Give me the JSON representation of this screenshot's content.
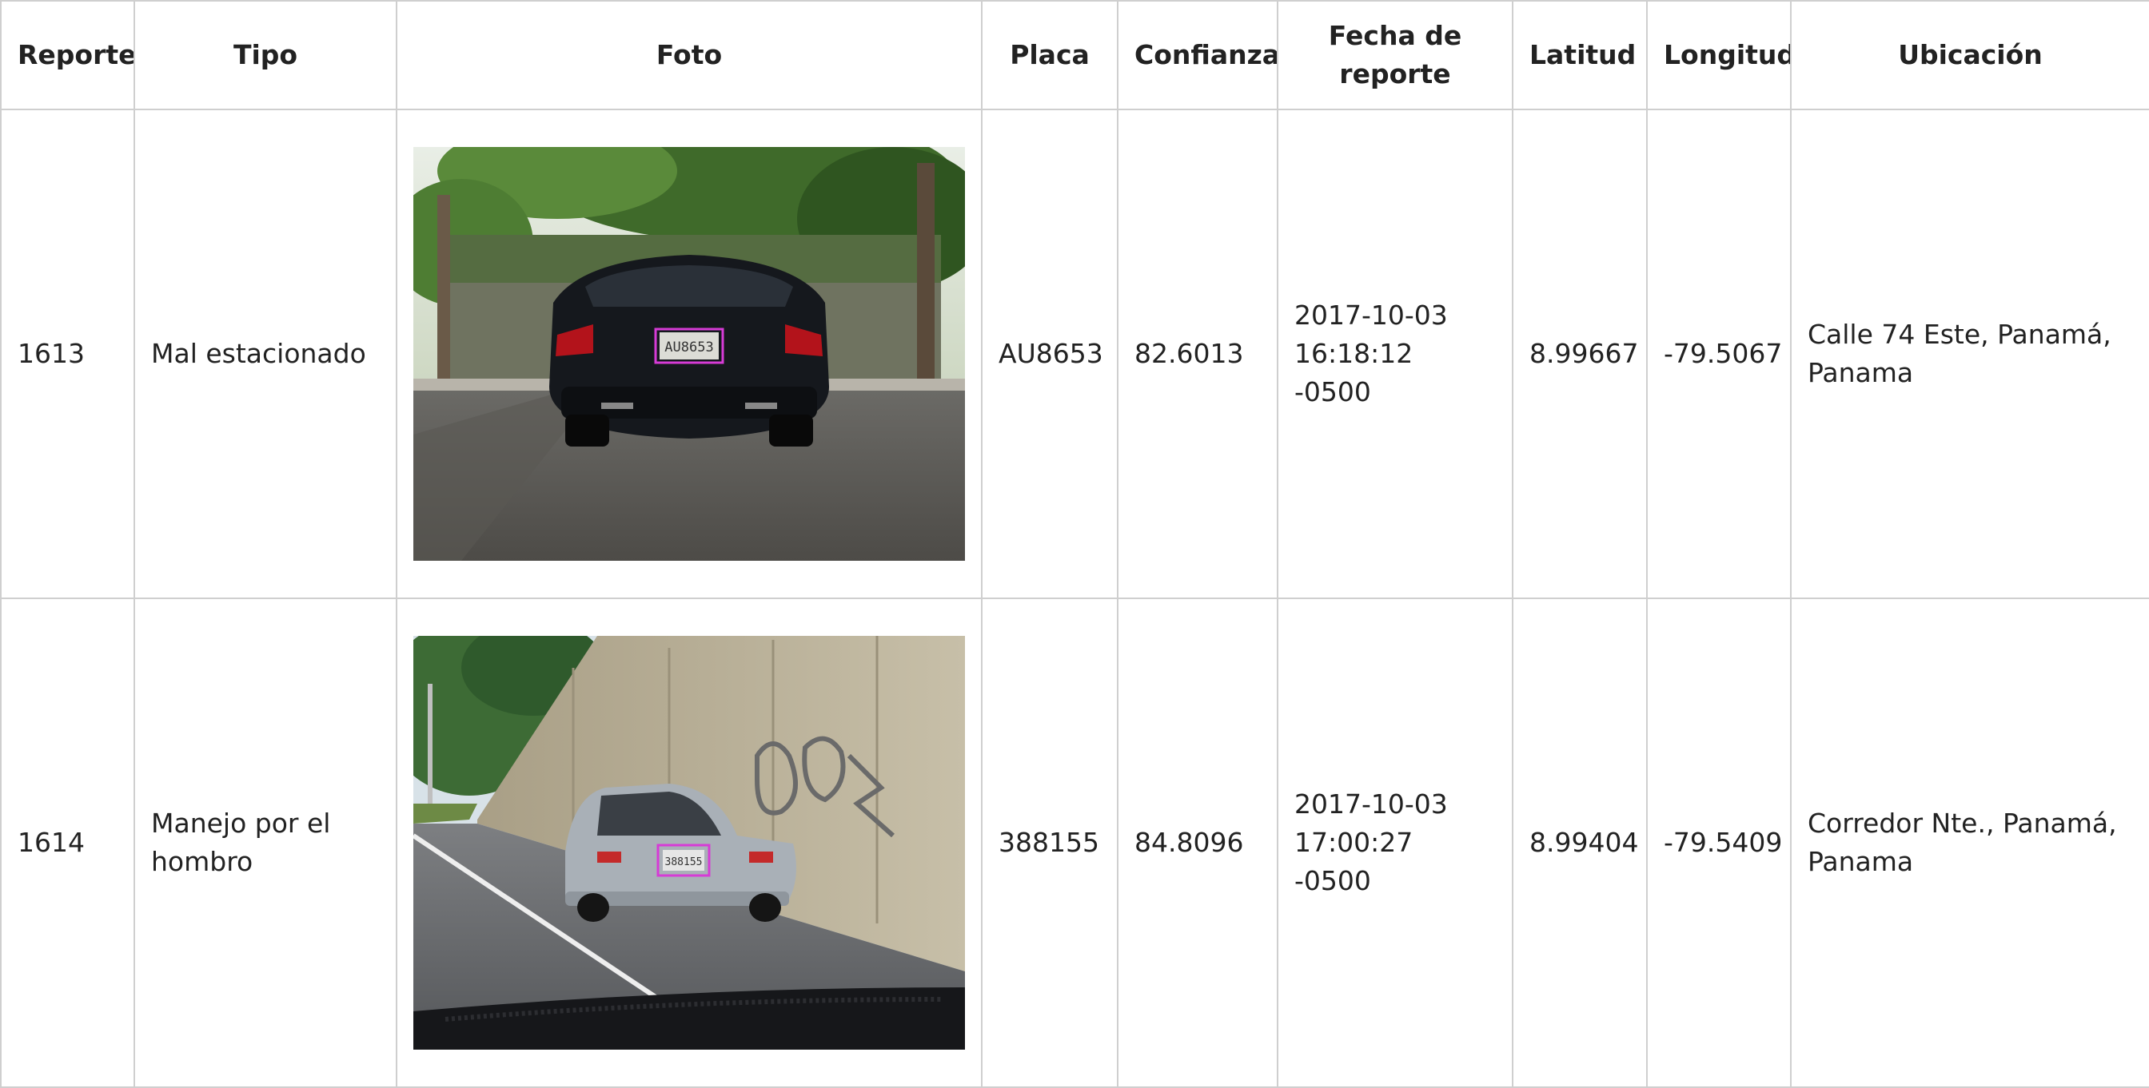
{
  "table": {
    "headers": [
      "Reporte",
      "Tipo",
      "Foto",
      "Placa",
      "Confianza",
      "Fecha de reporte",
      "Latitud",
      "Longitud",
      "Ubicación"
    ],
    "rows": [
      {
        "reporte": "1613",
        "tipo": "Mal estacionado",
        "foto_plate_text": "AU8653",
        "placa": "AU8653",
        "confianza": "82.6013",
        "fecha": "2017-10-03 16:18:12 -0500",
        "latitud": "8.99667",
        "longitud": "-79.5067",
        "ubicacion": "Calle 74 Este, Panamá, Panama"
      },
      {
        "reporte": "1614",
        "tipo": "Manejo por el hombro",
        "foto_plate_text": "388155",
        "placa": "388155",
        "confianza": "84.8096",
        "fecha": "2017-10-03 17:00:27 -0500",
        "latitud": "8.99404",
        "longitud": "-79.5409",
        "ubicacion": "Corredor Nte., Panamá, Panama"
      }
    ]
  },
  "colors": {
    "border": "#cfcfcf",
    "plate_highlight": "#d63bd6"
  }
}
